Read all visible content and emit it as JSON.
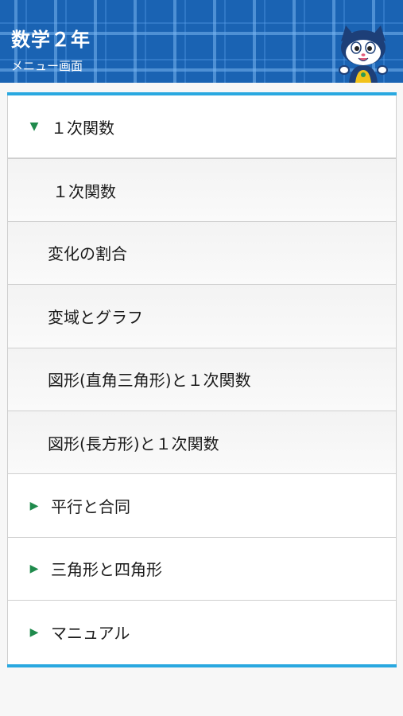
{
  "header": {
    "title": "数学２年",
    "subtitle": "メニュー画面",
    "mascot_icon": "cat-mascot-icon"
  },
  "colors": {
    "header_blue": "#1a63b3",
    "accent_cyan": "#29a8e0",
    "arrow_green": "#1f8a4c"
  },
  "menu": {
    "sections": [
      {
        "label": "１次関数",
        "expanded": true,
        "indicator": "▼",
        "items": [
          {
            "label": "１次関数"
          },
          {
            "label": "変化の割合"
          },
          {
            "label": "変域とグラフ"
          },
          {
            "label": "図形(直角三角形)と１次関数"
          },
          {
            "label": "図形(長方形)と１次関数"
          }
        ]
      },
      {
        "label": "平行と合同",
        "expanded": false,
        "indicator": "▶"
      },
      {
        "label": "三角形と四角形",
        "expanded": false,
        "indicator": "▶"
      },
      {
        "label": "マニュアル",
        "expanded": false,
        "indicator": "▶"
      }
    ]
  }
}
